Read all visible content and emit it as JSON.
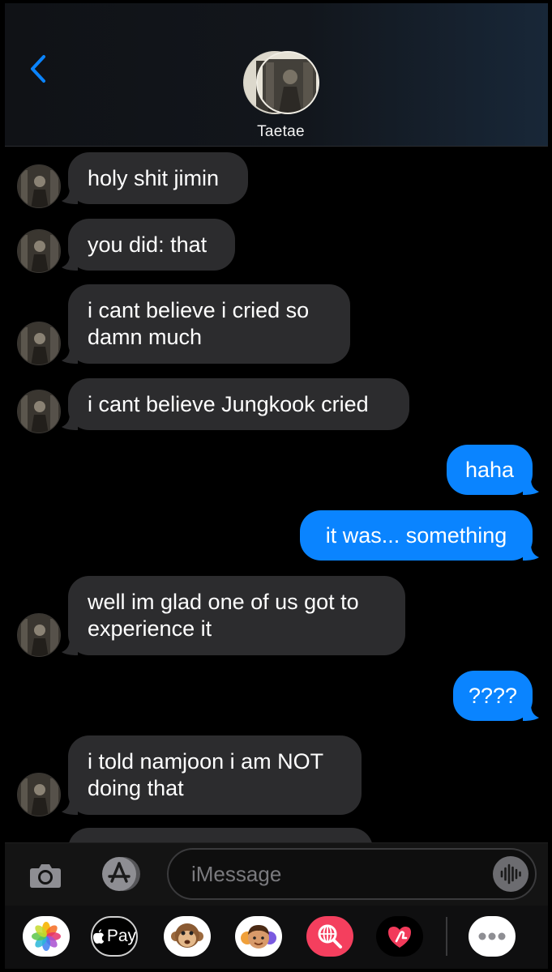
{
  "header": {
    "contact_name": "Taetae",
    "back_icon": "chevron-left-icon"
  },
  "messages": [
    {
      "direction": "incoming",
      "lines": [
        "holy shit jimin"
      ]
    },
    {
      "direction": "incoming",
      "lines": [
        "you did: that"
      ]
    },
    {
      "direction": "incoming",
      "lines": [
        "i cant believe i cried so",
        "damn much"
      ]
    },
    {
      "direction": "incoming",
      "lines": [
        "i cant believe Jungkook cried"
      ]
    },
    {
      "direction": "outgoing",
      "lines": [
        "haha"
      ]
    },
    {
      "direction": "outgoing",
      "lines": [
        "it was... something"
      ]
    },
    {
      "direction": "incoming",
      "lines": [
        "well im glad one of us got to",
        "experience it"
      ]
    },
    {
      "direction": "outgoing",
      "lines": [
        "????"
      ]
    },
    {
      "direction": "incoming",
      "lines": [
        "i told namjoon i am NOT",
        "doing that"
      ]
    }
  ],
  "input_bar": {
    "placeholder": "iMessage",
    "icons": [
      "camera-icon",
      "app-store-icon",
      "voice-waveform-icon"
    ]
  },
  "app_drawer": {
    "apple_pay_label": "Pay",
    "apps": [
      "photos-icon",
      "apple-pay-icon",
      "monkey-animoji-icon",
      "memoji-icon",
      "web-search-icon",
      "digital-touch-icon",
      "more-icon"
    ]
  },
  "colors": {
    "incoming_bubble": "#2c2c2e",
    "outgoing_bubble": "#0a84ff",
    "accent": "#0a84ff",
    "background": "#000000"
  }
}
